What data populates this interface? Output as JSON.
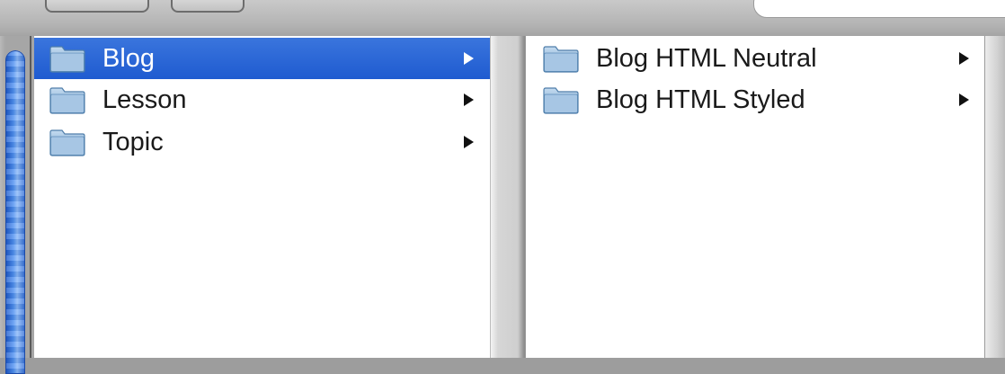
{
  "colors": {
    "selection": "#2a67d6",
    "folder": "#8fb4d8",
    "text": "#1a1a1a",
    "selected_text": "#ffffff"
  },
  "column1": {
    "items": [
      {
        "label": "Blog",
        "icon": "folder-icon",
        "has_submenu": true,
        "selected": true
      },
      {
        "label": "Lesson",
        "icon": "folder-icon",
        "has_submenu": true,
        "selected": false
      },
      {
        "label": "Topic",
        "icon": "folder-icon",
        "has_submenu": true,
        "selected": false
      }
    ]
  },
  "column2": {
    "items": [
      {
        "label": "Blog HTML Neutral",
        "icon": "folder-icon",
        "has_submenu": true,
        "selected": false
      },
      {
        "label": "Blog HTML Styled",
        "icon": "folder-icon",
        "has_submenu": true,
        "selected": false
      }
    ]
  }
}
